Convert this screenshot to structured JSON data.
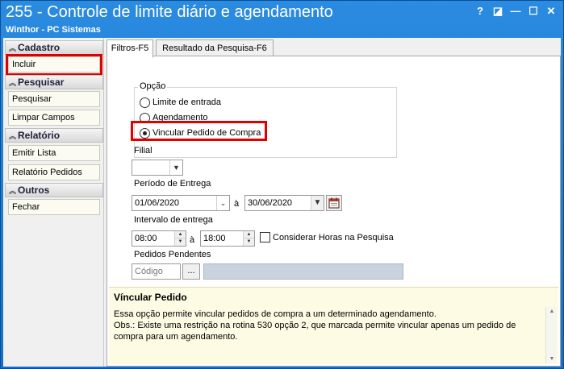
{
  "window": {
    "title": "255 - Controle de limite diário e agendamento",
    "subtitle": "Winthor - PC Sistemas",
    "help_btn": "?",
    "restore_btn": "◪",
    "minimize_btn": "—",
    "maximize_btn": "☐",
    "close_btn": "✕"
  },
  "sidebar": {
    "groups": [
      {
        "label": "Cadastro",
        "items": [
          "Incluir"
        ]
      },
      {
        "label": "Pesquisar",
        "items": [
          "Pesquisar",
          "Limpar Campos"
        ]
      },
      {
        "label": "Relatório",
        "items": [
          "Emitir Lista",
          "Relatório Pedidos"
        ]
      },
      {
        "label": "Outros",
        "items": [
          "Fechar"
        ]
      }
    ]
  },
  "tabs": [
    "Filtros-F5",
    "Resultado da Pesquisa-F6"
  ],
  "filters": {
    "option_label": "Opção",
    "options": [
      "Limite de entrada",
      "Agendamento",
      "Vincular Pedido de Compra"
    ],
    "selected_option": "Vincular Pedido de Compra",
    "filial_label": "Filial",
    "filial_value": "",
    "periodo_label": "Período de Entrega",
    "date_from": "01/06/2020",
    "date_sep": "à",
    "date_to": "30/06/2020",
    "intervalo_label": "Intervalo de entrega",
    "time_from": "08:00",
    "time_sep": "à",
    "time_to": "18:00",
    "considerar_label": "Considerar Horas na Pesquisa",
    "considerar_checked": false,
    "pedidos_label": "Pedidos Pendentes",
    "codigo_placeholder": "Código",
    "ellipsis": "..."
  },
  "help": {
    "title": "Víncular Pedido",
    "line1": "Essa opção permite vincular pedidos de compra a um determinado agendamento.",
    "line2": "Obs.: Existe uma restrição na rotina 530 opção 2, que marcada permite vincular apenas um pedido de compra para um agendamento."
  },
  "colors": {
    "titlebar": "#1b7fd4",
    "highlight": "#e00000",
    "help_bg": "#fdfbe3"
  }
}
